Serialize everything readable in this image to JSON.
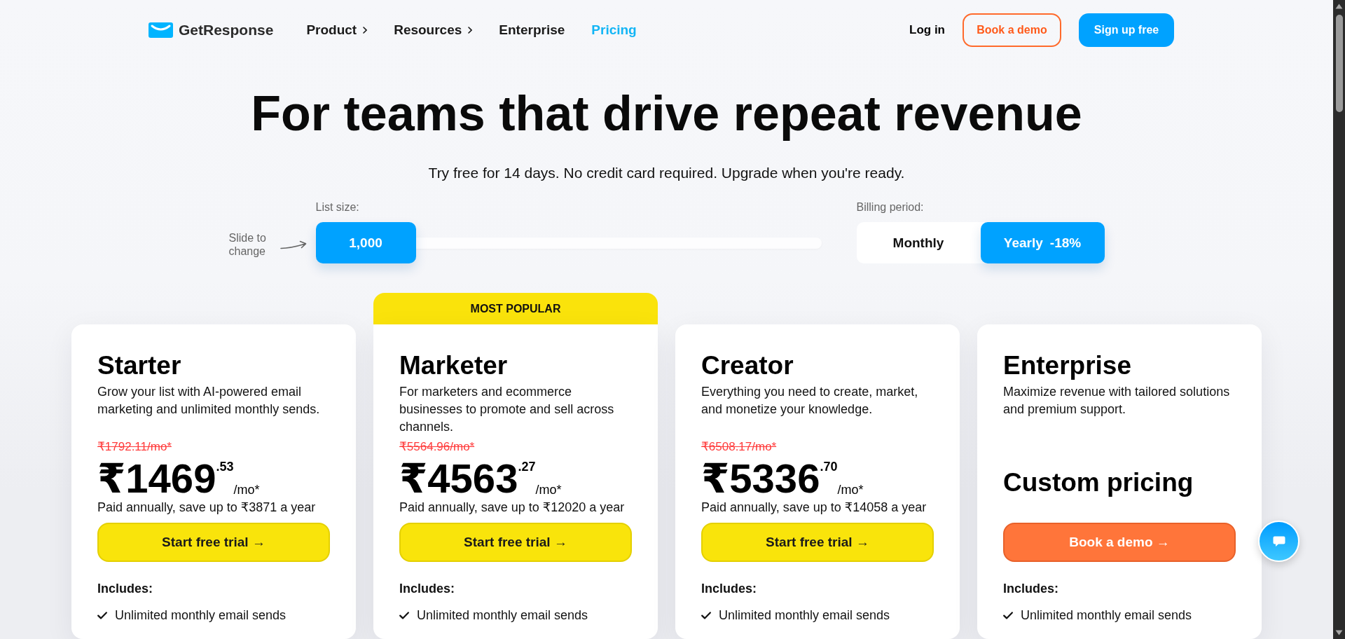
{
  "header": {
    "logo": "GetResponse",
    "nav": [
      {
        "label": "Product",
        "has_submenu": true,
        "selected": false
      },
      {
        "label": "Resources",
        "has_submenu": true,
        "selected": false
      },
      {
        "label": "Enterprise",
        "has_submenu": false,
        "selected": false
      },
      {
        "label": "Pricing",
        "has_submenu": false,
        "selected": true
      }
    ],
    "login": "Log in",
    "demo_button": "Book a demo",
    "signup_button": "Sign up free"
  },
  "hero": {
    "title": "For teams that drive repeat revenue",
    "subtitle": "Try free for 14 days. No credit card required. Upgrade when you're ready."
  },
  "list_size": {
    "hint": "Slide to change",
    "label": "List size:",
    "value": "1,000",
    "level": 0
  },
  "billing": {
    "label": "Billing period:",
    "options": [
      {
        "label": "Monthly",
        "selected": false
      },
      {
        "label": "Yearly",
        "discount": "-18%",
        "selected": true
      }
    ]
  },
  "plans": [
    {
      "kind": "standard",
      "name": "Starter",
      "description": "Grow your list with AI-powered email marketing and unlimited monthly sends.",
      "old_price": "₹1792.11/mo*",
      "price": "₹1469",
      "cents": ".53",
      "unit": "/mo*",
      "savings": "Paid annually, save up to ₹3871 a year",
      "cta": "Start free trial →",
      "includes_label": "Includes:",
      "features": [
        "Unlimited monthly email sends"
      ]
    },
    {
      "kind": "standard",
      "badge": "MOST POPULAR",
      "name": "Marketer",
      "description": "For marketers and ecommerce businesses to promote and sell across channels.",
      "old_price": "₹5564.96/mo*",
      "price": "₹4563",
      "cents": ".27",
      "unit": "/mo*",
      "savings": "Paid annually, save up to ₹12020 a year",
      "cta": "Start free trial →",
      "includes_label": "Includes:",
      "features": [
        "Unlimited monthly email sends"
      ]
    },
    {
      "kind": "standard",
      "name": "Creator",
      "description": "Everything you need to create, market, and monetize your knowledge.",
      "old_price": "₹6508.17/mo*",
      "price": "₹5336",
      "cents": ".70",
      "unit": "/mo*",
      "savings": "Paid annually, save up to ₹14058 a year",
      "cta": "Start free trial →",
      "includes_label": "Includes:",
      "features": [
        "Unlimited monthly email sends"
      ]
    },
    {
      "kind": "custom",
      "name": "Enterprise",
      "description": "Maximize revenue with tailored solutions and premium support.",
      "custom_price": "Custom pricing",
      "cta": "Book a demo →",
      "includes_label": "Includes:",
      "features": [
        "Unlimited monthly email sends"
      ]
    }
  ]
}
